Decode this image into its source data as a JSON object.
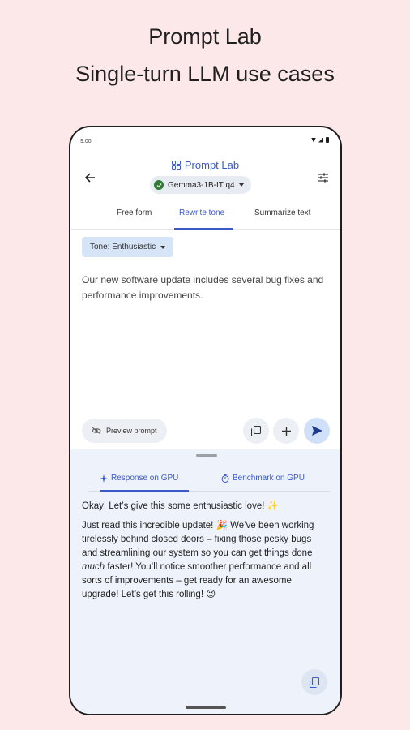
{
  "promo": {
    "title": "Prompt Lab",
    "subtitle": "Single-turn LLM use cases"
  },
  "status_bar": {
    "time": "9:00"
  },
  "header": {
    "title": "Prompt Lab",
    "model": "Gemma3-1B-IT q4"
  },
  "tabs": [
    {
      "label": "Free form",
      "active": false
    },
    {
      "label": "Rewrite tone",
      "active": true
    },
    {
      "label": "Summarize text",
      "active": false
    }
  ],
  "input": {
    "tone_chip": "Tone: Enthusiastic",
    "prompt_text": "Our new software update includes several bug fixes and performance improvements.",
    "preview_label": "Preview prompt"
  },
  "response": {
    "tabs": [
      {
        "label": "Response on GPU",
        "active": true
      },
      {
        "label": "Benchmark on GPU",
        "active": false
      }
    ],
    "para1": "Okay! Let’s give this some enthusiastic love! ✨",
    "para2_start": "Just read this incredible update! 🎉 We’ve been working tirelessly behind closed doors – fixing those pesky bugs and streamlining our system so you can get things done ",
    "para2_emph": "much",
    "para2_end": " faster! You’ll notice smoother performance and all sorts of improvements – get ready for an awesome upgrade! Let’s get this rolling! 😉"
  },
  "colors": {
    "accent": "#3b59c9",
    "background": "#fce8e8"
  }
}
